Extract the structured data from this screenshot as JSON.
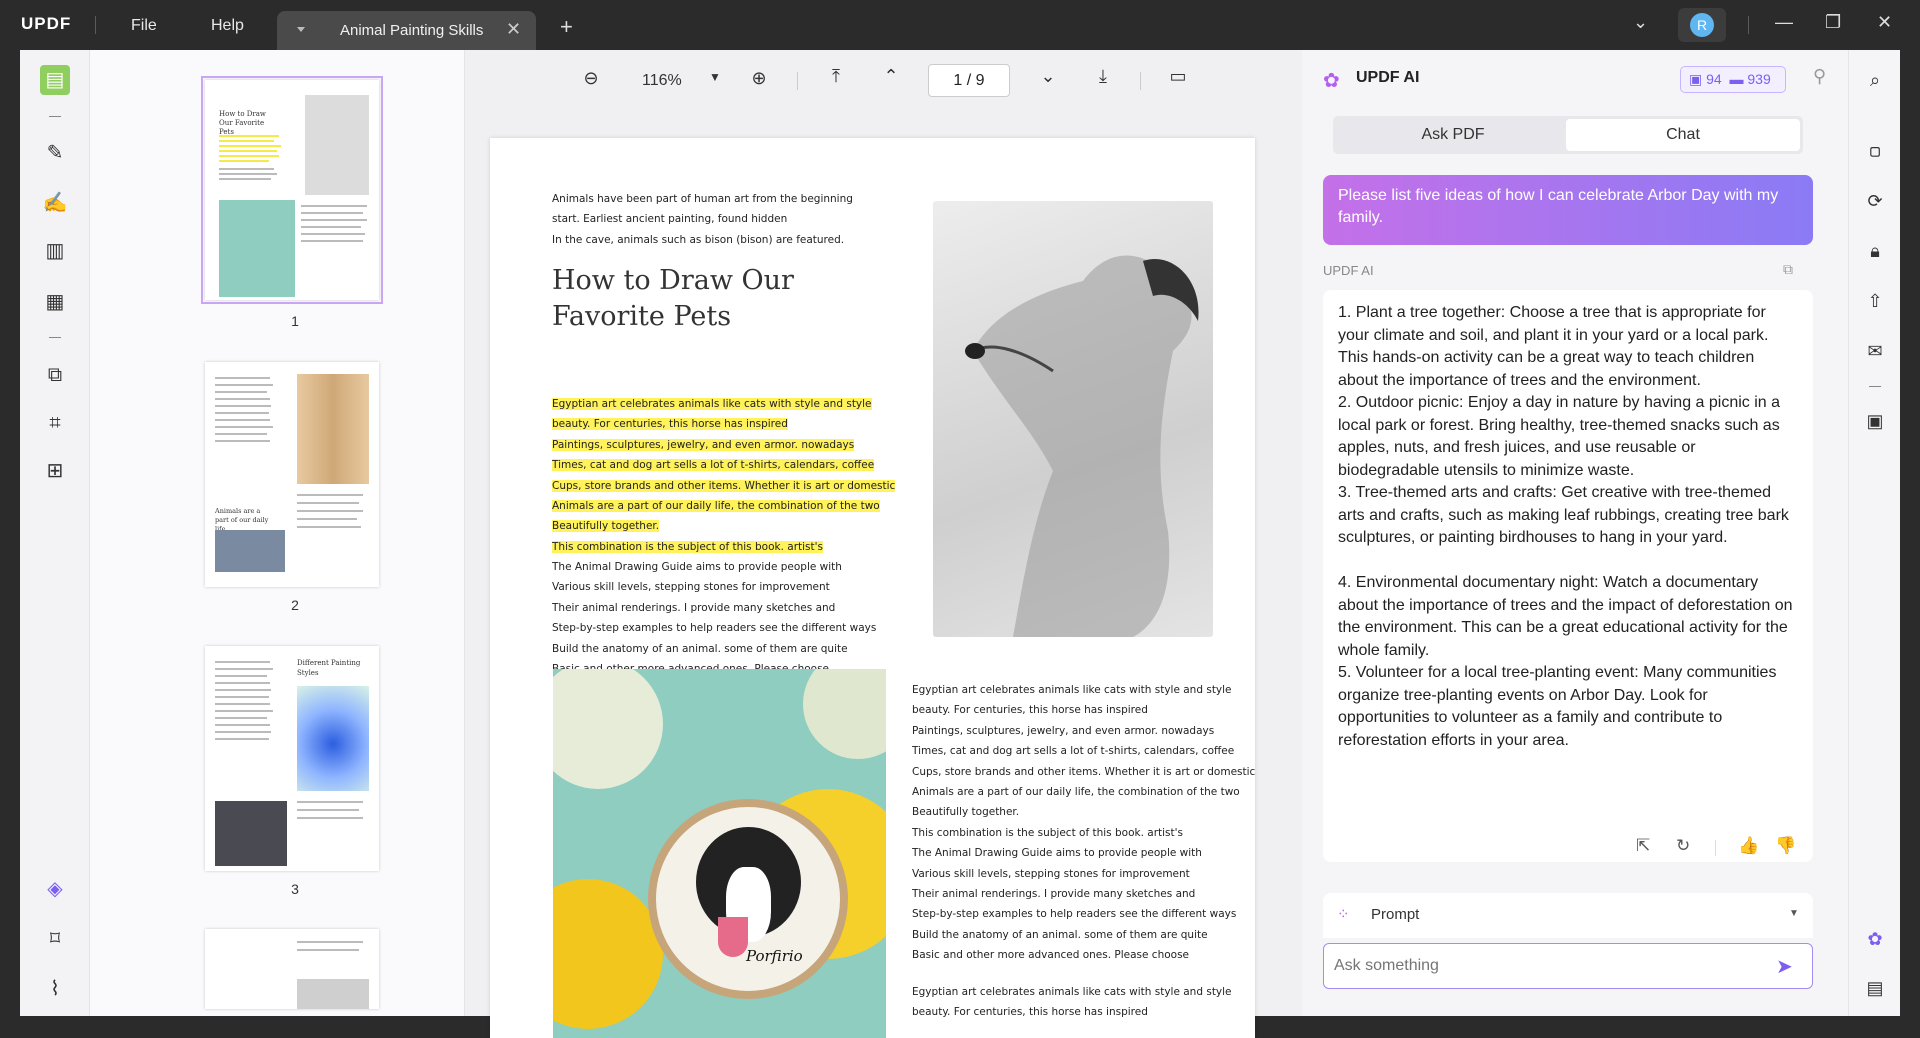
{
  "app": {
    "logo": "UPDF",
    "menu_file": "File",
    "menu_help": "Help"
  },
  "tab": {
    "title": "Animal Painting Skills"
  },
  "user": {
    "initial": "R"
  },
  "viewer": {
    "zoom": "116%",
    "page_display": "1 / 9"
  },
  "thumbnails": [
    {
      "number": "1"
    },
    {
      "number": "2"
    },
    {
      "number": "3"
    }
  ],
  "thumb_text": {
    "p1_title": "How to Draw Our Favorite Pets",
    "p2_heading": "Animals are a part of our daily life",
    "p3_heading": "Different Painting Styles"
  },
  "page": {
    "intro": [
      "Animals have been part of human art from the beginning",
      "start. Earliest ancient painting, found hidden",
      "In the cave, animals such as bison (bison) are featured."
    ],
    "title_line1": "How to Draw Our",
    "title_line2": "Favorite Pets",
    "highlighted": [
      "Egyptian art celebrates animals like cats with style and style",
      "beauty. For centuries, this horse has inspired",
      "Paintings, sculptures, jewelry, and even armor. nowadays",
      "Times, cat and dog art sells a lot of t-shirts, calendars, coffee",
      "Cups, store brands and other items. Whether it is art or domestic",
      "Animals are a part of our daily life, the combination of the two",
      "Beautifully together.",
      "This combination is the subject of this book. artist's"
    ],
    "body": [
      "The Animal Drawing Guide aims to provide people with",
      "Various skill levels, stepping stones for improvement",
      "Their animal renderings. I provide many sketches and",
      "Step-by-step examples to help readers see the different ways",
      "Build the anatomy of an animal. some of them are quite",
      "Basic and other more advanced ones. Please choose"
    ],
    "right_col": [
      "Egyptian art celebrates animals like cats with style and style",
      "beauty. For centuries, this horse has inspired",
      "Paintings, sculptures, jewelry, and even armor. nowadays",
      "Times, cat and dog art sells a lot of t-shirts, calendars, coffee",
      "Cups, store brands and other items. Whether it is art or domestic",
      "Animals are a part of our daily life, the combination of the two",
      "Beautifully together.",
      "This combination is the subject of this book. artist's",
      "The Animal Drawing Guide aims to provide people with",
      "Various skill levels, stepping stones for improvement",
      "Their animal renderings. I provide many sketches and",
      "Step-by-step examples to help readers see the different ways",
      "Build the anatomy of an animal. some of them are quite",
      "Basic and other more advanced ones. Please choose"
    ],
    "right_col2": [
      "Egyptian art celebrates animals like cats with style and style",
      "beauty. For centuries, this horse has inspired"
    ],
    "embroidery_text": "Porfirio"
  },
  "ai": {
    "title": "UPDF AI",
    "credit_pdf": "94",
    "credit_chat": "939",
    "tab_ask": "Ask PDF",
    "tab_chat": "Chat",
    "user_message": "Please list five ideas of how I can celebrate Arbor Day with my family.",
    "label": "UPDF AI",
    "answers": [
      "1. Plant a tree together: Choose a tree that is appropriate for your climate and soil, and plant it in your yard or a local park. This hands-on activity can be a great way to teach children about the importance of trees and the environment.",
      "2. Outdoor picnic: Enjoy a day in nature by having a picnic in a local park or forest. Bring healthy, tree-themed snacks such as apples, nuts, and fresh juices, and use reusable or biodegradable utensils to minimize waste.",
      "3. Tree-themed arts and crafts: Get creative with tree-themed arts and crafts, such as making leaf rubbings, creating tree bark sculptures, or painting birdhouses to hang in your yard.",
      "4. Environmental documentary night: Watch a documentary about the importance of trees and the impact of deforestation on the environment. This can be a great educational activity for the whole family.",
      "5. Volunteer for a local tree-planting event: Many communities organize tree-planting events on Arbor Day. Look for opportunities to volunteer as a family and contribute to reforestation efforts in your area."
    ],
    "prompt_label": "Prompt",
    "ask_placeholder": "Ask something"
  },
  "colors": {
    "accent": "#7c5ff0",
    "highlight": "#fff25a",
    "active_tool": "#8fce5f"
  }
}
